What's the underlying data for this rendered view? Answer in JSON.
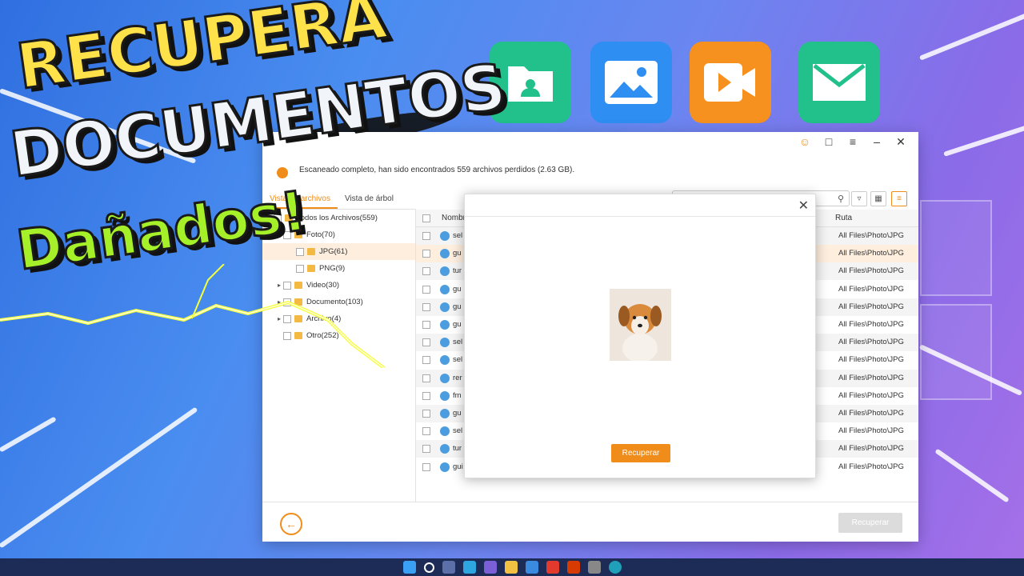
{
  "thumbnail": {
    "title_line1": "RECUPERA",
    "title_line2": "DOCUMENTOS",
    "title_line3": "Dañados!"
  },
  "app_icons": [
    "folder-user-icon",
    "image-icon",
    "video-icon",
    "mail-icon"
  ],
  "window": {
    "status_text": "Escaneado completo, han sido encontrados 559 archivos perdidos (2.63 GB).",
    "tabs": [
      "Vista de archivos",
      "Vista de árbol"
    ],
    "tree": [
      {
        "label": "Todos los Archivos(559)"
      },
      {
        "label": "Foto(70)"
      },
      {
        "label": "JPG(61)"
      },
      {
        "label": "PNG(9)"
      },
      {
        "label": "Video(30)"
      },
      {
        "label": "Documento(103)"
      },
      {
        "label": "Archivo(4)"
      },
      {
        "label": "Otro(252)"
      }
    ],
    "columns": {
      "name": "Nombre",
      "path": "Ruta"
    },
    "rows": [
      {
        "name": "sel",
        "path": "All Files\\Photo\\JPG"
      },
      {
        "name": "gu",
        "path": "All Files\\Photo\\JPG"
      },
      {
        "name": "tur",
        "path": "All Files\\Photo\\JPG"
      },
      {
        "name": "gu",
        "path": "All Files\\Photo\\JPG"
      },
      {
        "name": "gu",
        "path": "All Files\\Photo\\JPG"
      },
      {
        "name": "gu",
        "path": "All Files\\Photo\\JPG"
      },
      {
        "name": "sel",
        "path": "All Files\\Photo\\JPG"
      },
      {
        "name": "sel",
        "path": "All Files\\Photo\\JPG"
      },
      {
        "name": "rer",
        "path": "All Files\\Photo\\JPG"
      },
      {
        "name": "fm",
        "path": "All Files\\Photo\\JPG"
      },
      {
        "name": "gu",
        "path": "All Files\\Photo\\JPG"
      },
      {
        "name": "sel",
        "path": "All Files\\Photo\\JPG"
      },
      {
        "name": "tur",
        "path": "All Files\\Photo\\JPG"
      },
      {
        "name": "gui",
        "path": "All Files\\Photo\\JPG"
      }
    ],
    "recover_label": "Recuperar"
  },
  "dialog": {
    "recover_label": "Recuperar"
  },
  "colors": {
    "accent": "#f08c1a",
    "title_yellow": "#ffe14a",
    "title_green": "#a6f02a"
  }
}
